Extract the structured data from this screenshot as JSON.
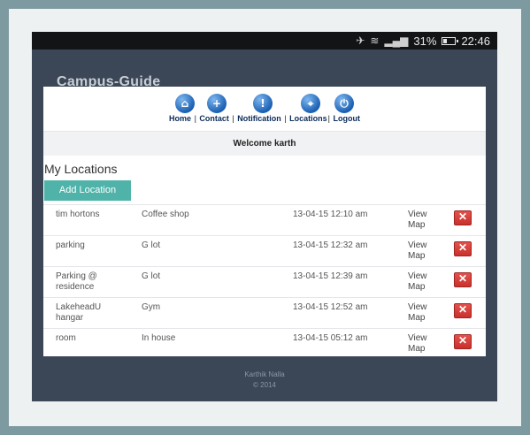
{
  "status_bar": {
    "battery_percent": "31%",
    "battery_level": 0.31,
    "time": "22:46",
    "icons": [
      "silent-icon",
      "wifi-icon",
      "signal-icon",
      "battery-icon"
    ]
  },
  "app": {
    "title": "Campus-Guide"
  },
  "nav": {
    "items": [
      {
        "label": "Home",
        "icon": "home-icon",
        "glyph": "⌂"
      },
      {
        "label": "Contact",
        "icon": "plus-icon",
        "glyph": "+"
      },
      {
        "label": "Notification",
        "icon": "exclamation-icon",
        "glyph": "!"
      },
      {
        "label": "Locations",
        "icon": "location-icon",
        "glyph": "⌖"
      },
      {
        "label": "Logout",
        "icon": "logout-icon",
        "glyph": "⏻"
      }
    ]
  },
  "welcome": "Welcome karth",
  "locations": {
    "title": "My Locations",
    "add_label": "Add Location",
    "rows": [
      {
        "name": "tim hortons",
        "category": "Coffee shop",
        "datetime": "13-04-15 12:10 am",
        "link": "View Map",
        "delete": "✕"
      },
      {
        "name": "parking",
        "category": "G lot",
        "datetime": "13-04-15 12:32 am",
        "link": "View Map",
        "delete": "✕"
      },
      {
        "name": "Parking @ residence",
        "category": "G lot",
        "datetime": "13-04-15 12:39 am",
        "link": "View Map",
        "delete": "✕"
      },
      {
        "name": "LakeheadU hangar",
        "category": "Gym",
        "datetime": "13-04-15 12:52 am",
        "link": "View Map",
        "delete": "✕"
      },
      {
        "name": "room",
        "category": "In house",
        "datetime": "13-04-15 05:12 am",
        "link": "View Map",
        "delete": "✕"
      }
    ]
  },
  "footer": {
    "author": "Karthik Nalla",
    "copyright": "© 2014"
  },
  "colors": {
    "accent": "#4fb3a9",
    "delete": "#d9534f",
    "nav_blue": "#1b5fb3",
    "header_bg": "#3b4756"
  }
}
